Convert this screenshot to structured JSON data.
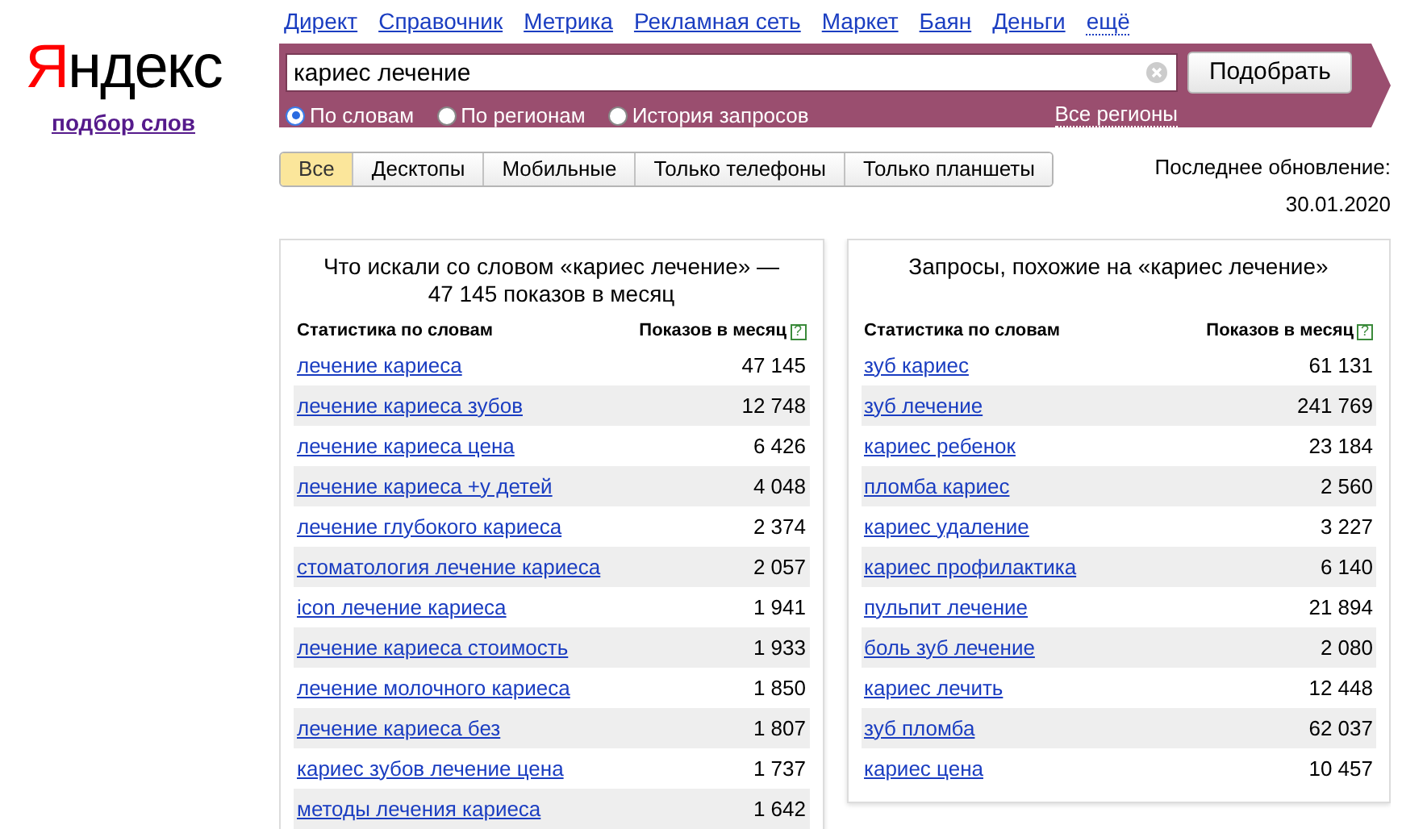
{
  "logo": "Яндекс",
  "subtitle_link": "подбор слов",
  "nav_links": [
    {
      "label": "Директ",
      "kind": "link"
    },
    {
      "label": "Справочник",
      "kind": "link"
    },
    {
      "label": "Метрика",
      "kind": "link"
    },
    {
      "label": "Рекламная сеть",
      "kind": "link"
    },
    {
      "label": "Маркет",
      "kind": "link"
    },
    {
      "label": "Баян",
      "kind": "link"
    },
    {
      "label": "Деньги",
      "kind": "link"
    },
    {
      "label": "ещё",
      "kind": "more"
    }
  ],
  "search": {
    "value": "кариес лечение",
    "button": "Подобрать"
  },
  "modes": [
    {
      "label": "По словам",
      "selected": true
    },
    {
      "label": "По регионам",
      "selected": false
    },
    {
      "label": "История запросов",
      "selected": false
    }
  ],
  "regions_link": "Все регионы",
  "device_tabs": [
    {
      "label": "Все",
      "selected": true
    },
    {
      "label": "Десктопы",
      "selected": false
    },
    {
      "label": "Мобильные",
      "selected": false
    },
    {
      "label": "Только телефоны",
      "selected": false
    },
    {
      "label": "Только планшеты",
      "selected": false
    }
  ],
  "last_update": {
    "label": "Последнее обновление:",
    "date": "30.01.2020"
  },
  "panels": [
    {
      "title": "Что искали со словом «кариес лечение» — 47 145 показов в месяц",
      "columns": [
        "Статистика по словам",
        "Показов в месяц"
      ],
      "help": "?",
      "rows": [
        {
          "phrase": "лечение кариеса",
          "count": "47 145"
        },
        {
          "phrase": "лечение кариеса зубов",
          "count": "12 748"
        },
        {
          "phrase": "лечение кариеса цена",
          "count": "6 426"
        },
        {
          "phrase": "лечение кариеса +у детей",
          "count": "4 048"
        },
        {
          "phrase": "лечение глубокого кариеса",
          "count": "2 374"
        },
        {
          "phrase": "стоматология лечение кариеса",
          "count": "2 057"
        },
        {
          "phrase": "icon лечение кариеса",
          "count": "1 941"
        },
        {
          "phrase": "лечение кариеса стоимость",
          "count": "1 933"
        },
        {
          "phrase": "лечение молочного кариеса",
          "count": "1 850"
        },
        {
          "phrase": "лечение кариеса без",
          "count": "1 807"
        },
        {
          "phrase": "кариес зубов лечение цена",
          "count": "1 737"
        },
        {
          "phrase": "методы лечения кариеса",
          "count": "1 642"
        }
      ]
    },
    {
      "title": "Запросы, похожие на «кариес лечение»",
      "columns": [
        "Статистика по словам",
        "Показов в месяц"
      ],
      "help": "?",
      "rows": [
        {
          "phrase": "зуб кариес",
          "count": "61 131"
        },
        {
          "phrase": "зуб лечение",
          "count": "241 769"
        },
        {
          "phrase": "кариес ребенок",
          "count": "23 184"
        },
        {
          "phrase": "пломба кариес",
          "count": "2 560"
        },
        {
          "phrase": "кариес удаление",
          "count": "3 227"
        },
        {
          "phrase": "кариес профилактика",
          "count": "6 140"
        },
        {
          "phrase": "пульпит лечение",
          "count": "21 894"
        },
        {
          "phrase": "боль зуб лечение",
          "count": "2 080"
        },
        {
          "phrase": "кариес лечить",
          "count": "12 448"
        },
        {
          "phrase": "зуб пломба",
          "count": "62 037"
        },
        {
          "phrase": "кариес цена",
          "count": "10 457"
        }
      ]
    }
  ]
}
